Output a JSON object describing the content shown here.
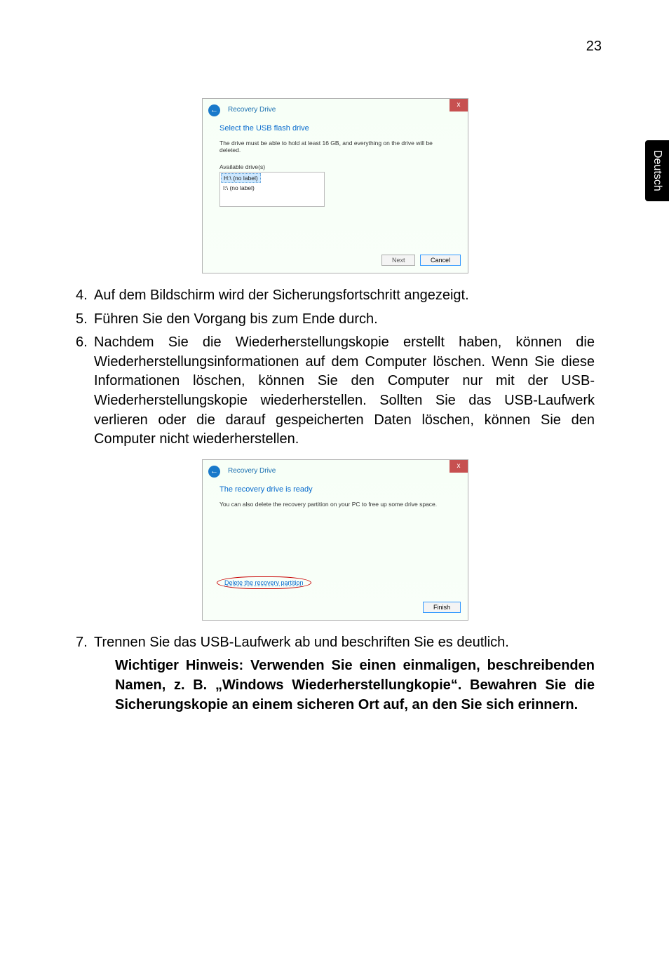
{
  "page_number": "23",
  "side_tab": "Deutsch",
  "dialog1": {
    "close": "x",
    "back_arrow": "←",
    "title": "Recovery Drive",
    "heading": "Select the USB flash drive",
    "instruction": "The drive must be able to hold at least 16 GB, and everything on the drive will be deleted.",
    "list_label": "Available drive(s)",
    "drive_selected": "H:\\ (no label)",
    "drive_unselected": "I:\\ (no label)",
    "btn_next": "Next",
    "btn_cancel": "Cancel"
  },
  "dialog2": {
    "close": "x",
    "back_arrow": "←",
    "title": "Recovery Drive",
    "heading": "The recovery drive is ready",
    "instruction": "You can also delete the recovery partition on your PC to free up some drive space.",
    "link": "Delete the recovery partition",
    "btn_finish": "Finish"
  },
  "steps": {
    "s4_num": "4.",
    "s4": "Auf dem Bildschirm wird der Sicherungsfortschritt angezeigt.",
    "s5_num": "5.",
    "s5": "Führen Sie den Vorgang bis zum Ende durch.",
    "s6_num": "6.",
    "s6": "Nachdem Sie die Wiederherstellungskopie erstellt haben, können die Wiederherstellungsinformationen auf dem Computer löschen. Wenn Sie diese Informationen löschen, können Sie den Computer nur mit der USB-Wiederherstellungskopie wiederherstellen. Sollten Sie das USB-Laufwerk verlieren oder die darauf gespeicherten Daten löschen, können Sie den Computer nicht wiederherstellen.",
    "s7_num": "7.",
    "s7": "Trennen Sie das USB-Laufwerk ab und beschriften Sie es deutlich."
  },
  "note": "Wichtiger Hinweis: Verwenden Sie einen einmaligen, beschreibenden Namen, z. B. „Windows Wiederherstellungkopie“. Bewahren Sie die Sicherungskopie an einem sicheren Ort auf, an den Sie sich erinnern."
}
